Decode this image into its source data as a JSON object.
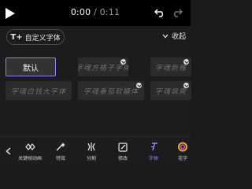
{
  "player": {
    "current_time": "0:00",
    "separator": " / ",
    "total_time": "0:11"
  },
  "panel": {
    "custom_font_label": "自定义字体",
    "custom_font_icon": "T+",
    "collapse_label": "收起",
    "fonts": [
      {
        "label": "默认",
        "selected": true,
        "downloadable": false
      },
      {
        "label": "字魂方格子字体",
        "selected": false,
        "downloadable": true
      },
      {
        "label": "字魂新雅",
        "selected": false,
        "downloadable": true
      },
      {
        "label": "字魂白钱大字体",
        "selected": false,
        "downloadable": false
      },
      {
        "label": "字魂番茄软糖体",
        "selected": false,
        "downloadable": true
      },
      {
        "label": "字魂飒爽",
        "selected": false,
        "downloadable": true
      }
    ]
  },
  "toolbar": {
    "items": [
      {
        "label": "关键帧动画",
        "icon": "keyframe-icon"
      },
      {
        "label": "特效",
        "icon": "effects-icon"
      },
      {
        "label": "分割",
        "icon": "split-icon"
      },
      {
        "label": "修改",
        "icon": "edit-icon"
      },
      {
        "label": "字体",
        "icon": "font-icon",
        "active": true
      },
      {
        "label": "花字",
        "icon": "fancy-text-icon"
      }
    ]
  },
  "colors": {
    "accent": "#8a86e8",
    "active_label": "#9a8cff"
  }
}
